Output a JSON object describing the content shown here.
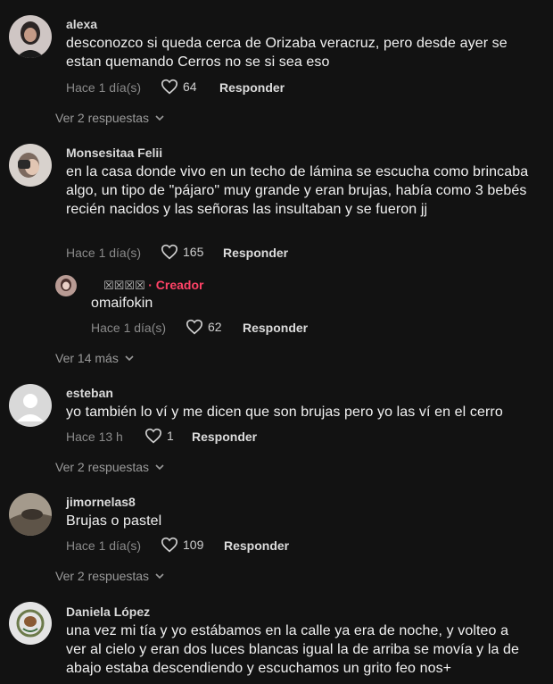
{
  "comments": [
    {
      "user": "alexa",
      "text": "desconozco si queda cerca de Orizaba veracruz, pero desde ayer se estan quemando Cerros no se si sea eso",
      "time": "Hace 1 día(s)",
      "likes": "64",
      "reply_label": "Responder",
      "more": "Ver 2 respuestas"
    },
    {
      "user": "Monsesitaa Felii",
      "text": "en la casa donde vivo en un techo de lámina se escucha como brincaba algo, un tipo de \"pájaro\" muy grande y eran brujas, había como 3 bebés recién nacidos y las señoras las insultaban y se fueron jj",
      "time": "Hace 1 día(s)",
      "likes": "165",
      "reply_label": "Responder",
      "reply": {
        "user": "☒☒☒☒",
        "creator_label": "· Creador",
        "text": "omaifokin",
        "time": "Hace 1 día(s)",
        "likes": "62",
        "reply_label": "Responder"
      },
      "more": "Ver 14 más"
    },
    {
      "user": "esteban",
      "text": "yo también lo ví y me dicen que son brujas pero yo las ví en el cerro",
      "time": "Hace 13 h",
      "likes": "1",
      "reply_label": "Responder",
      "more": "Ver 2 respuestas"
    },
    {
      "user": "jimornelas8",
      "text": "Brujas o pastel",
      "time": "Hace 1 día(s)",
      "likes": "109",
      "reply_label": "Responder",
      "more": "Ver 2 respuestas"
    },
    {
      "user": "Daniela López",
      "text": "una vez mi tía y yo estábamos en la calle ya era de noche, y volteo a ver al cielo y eran dos luces blancas igual la de arriba se movía y la de abajo estaba descendiendo y escuchamos un grito feo nos+"
    }
  ],
  "icons": {
    "like": "heart-outline-icon",
    "expand": "chevron-down-icon"
  },
  "colors": {
    "background": "#121212",
    "creator": "#ff4266",
    "secondary_text": "#8a8a8a"
  }
}
